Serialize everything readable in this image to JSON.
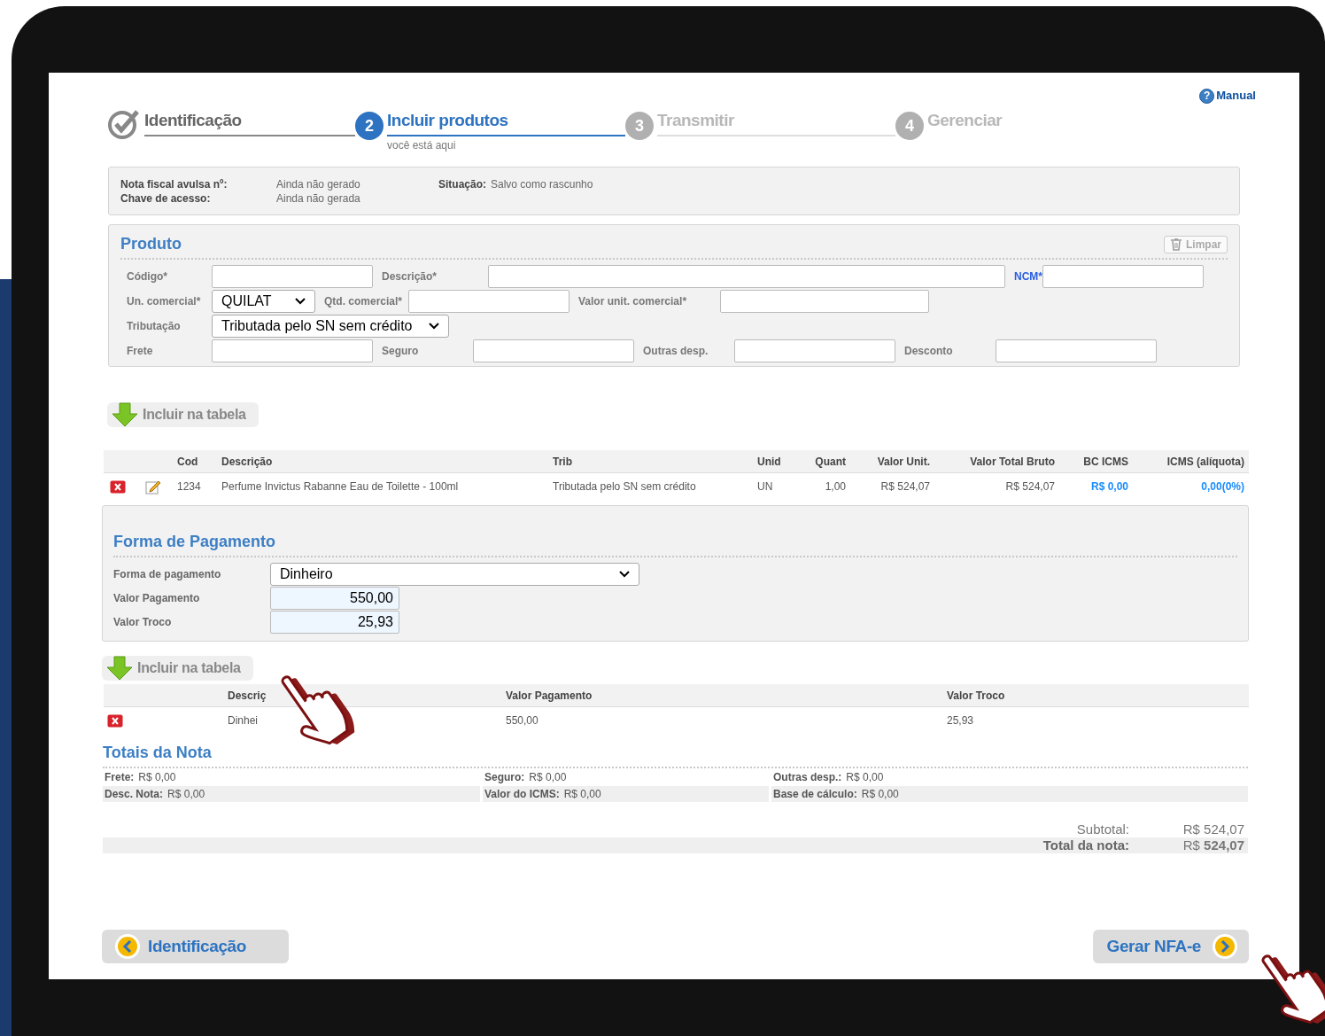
{
  "manual_icon": "?",
  "manual_link": "Manual",
  "steps": [
    {
      "label": "Identificação",
      "kind": "done"
    },
    {
      "number": "2",
      "label": "Incluir produtos",
      "sublabel": "você está aqui",
      "kind": "current"
    },
    {
      "number": "3",
      "label": "Transmitir",
      "kind": "pending"
    },
    {
      "number": "4",
      "label": "Gerenciar",
      "kind": "pending"
    }
  ],
  "info": {
    "rows": [
      {
        "label": "Nota fiscal avulsa nº:",
        "value": "Ainda não gerado"
      },
      {
        "label": "Chave de acesso:",
        "value": "Ainda não gerada"
      }
    ],
    "status": {
      "label": "Situação:",
      "value": "Salvo como rascunho"
    }
  },
  "produto": {
    "title": "Produto",
    "clear_button": "Limpar",
    "rows": [
      [
        {
          "label": "Código*",
          "kind": "input",
          "highlighted": false
        },
        {
          "label": "Descrição*",
          "kind": "input",
          "highlighted": false
        },
        {
          "label": "NCM*",
          "kind": "input",
          "highlighted": true
        }
      ],
      [
        {
          "label": "Un. comercial*",
          "kind": "select",
          "value": "QUILAT",
          "highlighted": false
        },
        {
          "label": "Qtd. comercial*",
          "kind": "input",
          "highlighted": false
        },
        {
          "label": "Valor unit. comercial*",
          "kind": "input",
          "highlighted": false
        }
      ],
      [
        {
          "label": "Tributação",
          "kind": "select",
          "value": "Tributada pelo SN sem crédito",
          "highlighted": false
        }
      ],
      [
        {
          "label": "Frete",
          "kind": "input",
          "highlighted": false
        },
        {
          "label": "Seguro",
          "kind": "input",
          "highlighted": false
        },
        {
          "label": "Outras desp.",
          "kind": "input",
          "highlighted": false
        },
        {
          "label": "Desconto",
          "kind": "input",
          "highlighted": false
        }
      ]
    ]
  },
  "include_button": "Incluir na tabela",
  "products_table": {
    "columns": [
      "Cod",
      "Descrição",
      "Trib",
      "Unid",
      "Quant",
      "Valor Unit.",
      "Valor Total Bruto",
      "BC ICMS",
      "ICMS (alíquota)"
    ],
    "rows": [
      {
        "cells": [
          "1234",
          "Perfume Invictus Rabanne Eau de Toilette - 100ml",
          "Tributada pelo SN sem crédito",
          "UN",
          "1,00",
          "R$ 524,07",
          "R$ 524,07",
          "R$ 0,00",
          "0,00(0%)"
        ]
      }
    ]
  },
  "payment": {
    "title": "Forma de Pagamento",
    "fields": [
      {
        "label": "Forma de pagamento",
        "kind": "select",
        "value": "Dinheiro"
      },
      {
        "label": "Valor Pagamento",
        "kind": "amount",
        "value": "550,00"
      },
      {
        "label": "Valor Troco",
        "kind": "amount",
        "value": "25,93"
      }
    ],
    "include_button": "Incluir na tabela",
    "table": {
      "columns": [
        "Descriç",
        "Valor Pagamento",
        "Valor Troco"
      ],
      "rows": [
        {
          "cells": [
            "Dinhei",
            "550,00",
            "25,93"
          ]
        }
      ]
    }
  },
  "totals": {
    "title": "Totais da Nota",
    "rows": [
      [
        {
          "label": "Frete:",
          "value": "R$ 0,00"
        },
        {
          "label": "Seguro:",
          "value": "R$ 0,00"
        },
        {
          "label": "Outras desp.:",
          "value": "R$ 0,00"
        }
      ],
      [
        {
          "label": "Desc. Nota:",
          "value": "R$ 0,00"
        },
        {
          "label": "Valor do ICMS:",
          "value": "R$ 0,00"
        },
        {
          "label": "Base de cálculo:",
          "value": "R$ 0,00"
        }
      ]
    ],
    "summary": [
      {
        "label": "Subtotal:",
        "value": "R$ 524,07",
        "kind": "subtotal"
      },
      {
        "label": "Total da nota:",
        "value": "R$ **524,07**",
        "kind": "total"
      }
    ]
  },
  "nav": {
    "back": "Identificação",
    "next": "Gerar NFA-e"
  }
}
